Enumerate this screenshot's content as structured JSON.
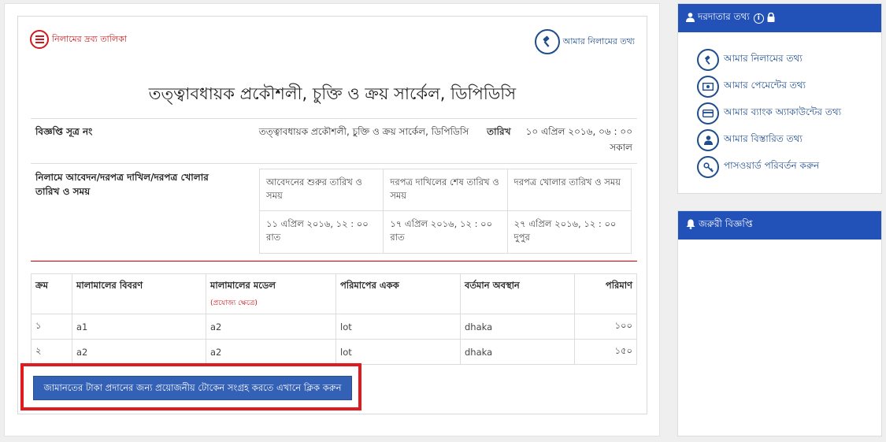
{
  "top_links": {
    "list_label": "নিলামের দ্রব্য তালিকা",
    "my_auction_label": "আমার নিলামের তথ্য"
  },
  "org_title": "তত্ত্বাবধায়ক প্রকৌশলী, চুক্তি ও ক্রয় সার্কেল, ডিপিডিসি",
  "notice_ref": {
    "label": "বিজ্ঞপ্তি সূত্র নং",
    "value": "তত্ত্বাবধায়ক প্রকৌশলী, চুক্তি ও ক্রয় সার্কেল, ডিপিডিসি",
    "date_label": "তারিখ",
    "date_value": "১০ এপ্রিল ২০১৬, ০৬ : ০০ সকাল"
  },
  "schedule": {
    "label": "নিলামে আবেদন/দরপত্র দাখিল/দরপত্র খোলার তারিখ ও সময়",
    "headers": [
      "আবেদনের শুরুর তারিখ ও সময়",
      "দরপত্র দাখিলের শেষ তারিখ ও সময়",
      "দরপত্র খোলার তারিখ ও সময়"
    ],
    "values": [
      "১১ এপ্রিল ২০১৬, ১২ : ০০ রাত",
      "১৭ এপ্রিল ২০১৬, ১২ : ০০ রাত",
      "২৭ এপ্রিল ২০১৬, ১২ : ০০ দুপুর"
    ]
  },
  "items": {
    "headers": {
      "serial": "ক্রম",
      "description": "মালামালের বিবরণ",
      "model": "মালামালের মডেল",
      "model_note": "(প্রযোজ্য ক্ষেত্রে)",
      "unit": "পরিমাপের একক",
      "location": "বর্তমান অবস্থান",
      "quantity": "পরিমাণ"
    },
    "rows": [
      {
        "serial": "১",
        "description": "a1",
        "model": "a2",
        "unit": "lot",
        "location": "dhaka",
        "quantity": "১০০"
      },
      {
        "serial": "২",
        "description": "a2",
        "model": "a2",
        "unit": "lot",
        "location": "dhaka",
        "quantity": "১৫০"
      }
    ]
  },
  "token_button_label": "জামানতের টাকা প্রদানের জন্য প্রয়োজনীয় টোকেন সংগ্রহ করতে এখানে ক্লিক করুন",
  "sidebar": {
    "title": "দরদাতার তথ্য",
    "items": [
      {
        "label": "আমার নিলামের তথ্য",
        "icon": "gavel-icon"
      },
      {
        "label": "আমার পেমেন্টের তথ্য",
        "icon": "money-icon"
      },
      {
        "label": "আমার ব্যাংক অ্যাকাউন্টের তথ্য",
        "icon": "credit-card-icon"
      },
      {
        "label": "আমার বিস্তারিত তথ্য",
        "icon": "user-icon"
      },
      {
        "label": "পাসওয়ার্ড পরিবর্তন করুন",
        "icon": "key-icon"
      }
    ],
    "notice_title": "জরুরী বিজ্ঞপ্তি"
  },
  "colors": {
    "primary": "#2251b8",
    "accent_red": "#c8161b",
    "link_blue": "#1f4d8c"
  }
}
